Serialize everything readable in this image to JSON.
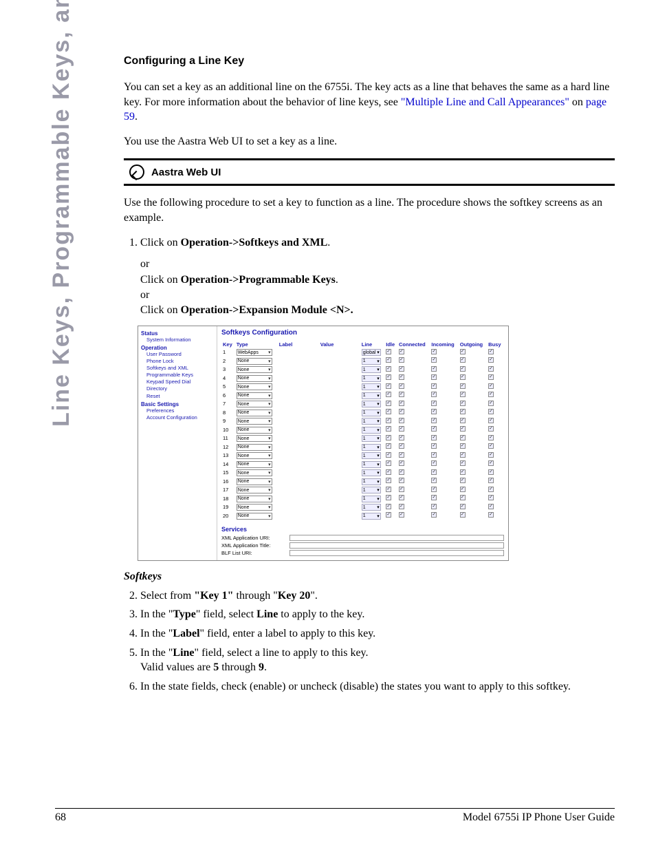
{
  "side_title": "Line Keys, Programmable Keys, and Softkeys",
  "section_title": "Configuring a Line Key",
  "intro_p1_a": "You can set a key as an additional line on the 6755i. The key acts as a line that behaves the same as a hard line key. For more information about the behavior of line keys, see ",
  "intro_link": "\"Multiple Line and Call Appearances\"",
  "intro_p1_b": " on ",
  "page_link": "page 59",
  "intro_p1_c": ".",
  "intro_p2": "You use the Aastra Web UI to set a key as a line.",
  "web_ui_label": "Aastra Web UI",
  "proc_intro": "Use the following procedure to set a key to function as a line. The procedure shows the softkey screens as an example.",
  "step1_a": "Click on ",
  "step1_b": "Operation->Softkeys and XML",
  "step1_c": ".",
  "or1": "or",
  "step1_alt1_a": "Click on ",
  "step1_alt1_b": "Operation->Programmable Keys",
  "step1_alt1_c": ".",
  "or2": "or",
  "step1_alt2_a": "Click on ",
  "step1_alt2_b": "Operation->Expansion Module <N>.",
  "softkeys_heading": "Softkeys",
  "step2_a": "Select from ",
  "step2_b": "\"Key 1\"",
  "step2_c": " through \"",
  "step2_d": "Key 20",
  "step2_e": "\".",
  "step3_a": "In the \"",
  "step3_b": "Type",
  "step3_c": "\" field, select ",
  "step3_d": "Line",
  "step3_e": " to apply to the key.",
  "step4_a": "In the \"",
  "step4_b": "Label",
  "step4_c": "\" field, enter a label to apply to this key.",
  "step5_a": "In the \"",
  "step5_b": "Line",
  "step5_c": "\" field, select a line to apply to this key.",
  "step5_line2_a": "Valid values are ",
  "step5_line2_b": "5",
  "step5_line2_c": " through ",
  "step5_line2_d": "9",
  "step5_line2_e": ".",
  "step6": "In the state fields, check (enable) or uncheck (disable) the states you want to apply to this softkey.",
  "footer_page": "68",
  "footer_title": "Model 6755i IP Phone User Guide",
  "ss": {
    "nav": {
      "status": "Status",
      "status_items": [
        "System Information"
      ],
      "operation": "Operation",
      "operation_items": [
        "User Password",
        "Phone Lock",
        "Softkeys and XML",
        "Programmable Keys",
        "Keypad Speed Dial",
        "Directory",
        "Reset"
      ],
      "basic": "Basic Settings",
      "basic_items": [
        "Preferences",
        "Account Configuration"
      ]
    },
    "title": "Softkeys Configuration",
    "headers": [
      "Key",
      "Type",
      "Label",
      "Value",
      "Line",
      "Idle",
      "Connected",
      "Incoming",
      "Outgoing",
      "Busy"
    ],
    "row1_type": "WebApps",
    "row1_line": "global",
    "other_type": "None",
    "other_line": "1",
    "services": "Services",
    "svc1": "XML Application URI:",
    "svc2": "XML Application Title:",
    "svc3": "BLF List URI:"
  }
}
